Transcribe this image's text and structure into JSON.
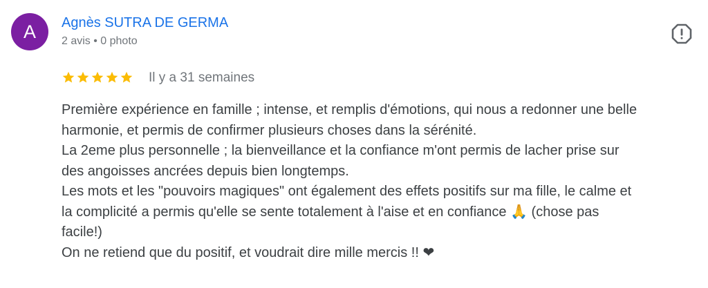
{
  "review": {
    "avatar_letter": "A",
    "avatar_color": "#7b1fa2",
    "author_name": "Agnès SUTRA DE GERMA",
    "author_meta": "2 avis • 0 photo",
    "flag_icon": "report-icon",
    "rating": 5,
    "rating_max": 5,
    "star_color": "#fbbc04",
    "time_ago": "Il y a 31 semaines",
    "text_lines": [
      "Première expérience en famille ; intense, et remplis d'émotions, qui nous a redonner une belle",
      "harmonie, et permis de confirmer plusieurs choses dans la sérénité.",
      "La 2eme plus personnelle ; la bienveillance et la confiance m'ont permis de lacher prise sur",
      "des angoisses ancrées depuis bien longtemps.",
      "Les mots et les \"pouvoirs magiques\" ont également des effets positifs sur ma fille, le calme et",
      "la complicité a permis qu'elle se sente totalement à l'aise et en confiance 🙏 (chose pas",
      "facile!)",
      "On ne retiend que du positif, et voudrait dire mille mercis !! ❤"
    ]
  }
}
